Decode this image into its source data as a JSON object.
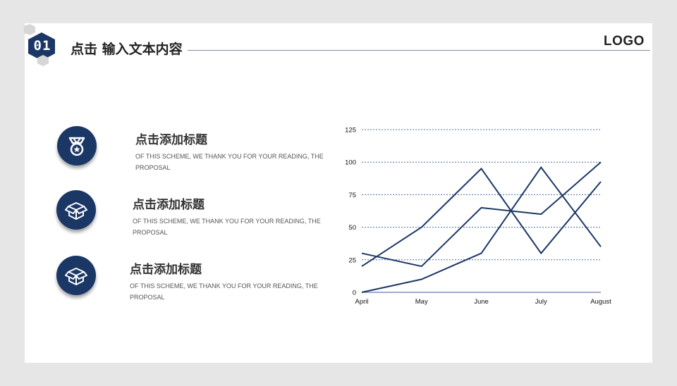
{
  "header": {
    "badge_number": "01",
    "title": "点击 输入文本内容",
    "logo": "LOGO"
  },
  "features": [
    {
      "title": "点击添加标题",
      "description": "OF THIS SCHEME, WE THANK YOU FOR YOUR READING, THE PROPOSAL",
      "icon": "medal-icon"
    },
    {
      "title": "点击添加标题",
      "description": "OF THIS SCHEME, WE THANK YOU FOR YOUR READING, THE PROPOSAL",
      "icon": "open-box-icon"
    },
    {
      "title": "点击添加标题",
      "description": "OF THIS SCHEME, WE THANK YOU FOR YOUR READING, THE PROPOSAL",
      "icon": "open-box-icon"
    }
  ],
  "colors": {
    "accent": "#1b3766",
    "grid": "#4a6aa5",
    "background": "#e6e6e6"
  },
  "chart_data": {
    "type": "line",
    "categories": [
      "April",
      "May",
      "June",
      "July",
      "August"
    ],
    "series": [
      {
        "values": [
          20,
          50,
          95,
          30,
          85
        ]
      },
      {
        "values": [
          30,
          20,
          65,
          60,
          100
        ]
      },
      {
        "values": [
          0,
          10,
          30,
          96,
          35
        ]
      }
    ],
    "yticks": [
      "0",
      "25",
      "50",
      "75",
      "100",
      "125"
    ],
    "ylim": [
      0,
      125
    ],
    "grid": true,
    "legend": "none"
  }
}
